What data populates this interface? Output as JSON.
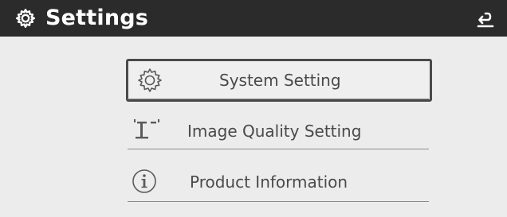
{
  "header": {
    "title": "Settings",
    "title_icon": "gear-icon",
    "back_icon": "back-arrow-icon"
  },
  "menu": {
    "items": [
      {
        "label": "System Setting",
        "icon": "gear-outline-icon",
        "selected": true
      },
      {
        "label": "Image Quality Setting",
        "icon": "image-quality-icon",
        "selected": false
      },
      {
        "label": "Product Information",
        "icon": "info-icon",
        "selected": false
      }
    ]
  },
  "colors": {
    "header_bg": "#2b2b2b",
    "header_text": "#ffffff",
    "body_bg": "#ececec",
    "menu_text": "#4a4a4a",
    "selected_border": "#4a4a4a"
  }
}
